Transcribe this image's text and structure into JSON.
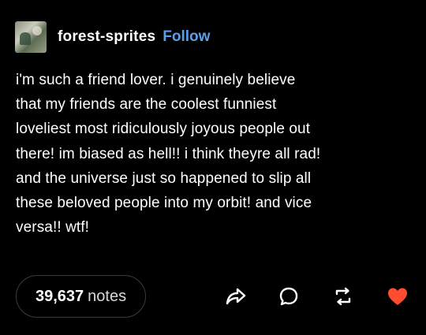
{
  "post": {
    "username": "forest-sprites",
    "follow_label": "Follow",
    "text": "i'm such a friend lover. i genuinely believe\nthat my friends are the coolest funniest\nloveliest most ridiculously joyous people out\nthere! im biased as hell!! i think theyre all rad!\nand the universe just so happened to slip all\nthese beloved people into my orbit! and vice\nversa!! wtf!",
    "notes_count": "39,637",
    "notes_label": "notes"
  },
  "actions": {
    "share_icon": "share-arrow-icon",
    "reply_icon": "reply-bubble-icon",
    "reblog_icon": "reblog-icon",
    "like_icon": "heart-icon"
  },
  "colors": {
    "background": "#000000",
    "follow": "#5aa0e8",
    "like": "#ff4c2e",
    "text": "#ffffff",
    "icon": "#ffffff"
  }
}
